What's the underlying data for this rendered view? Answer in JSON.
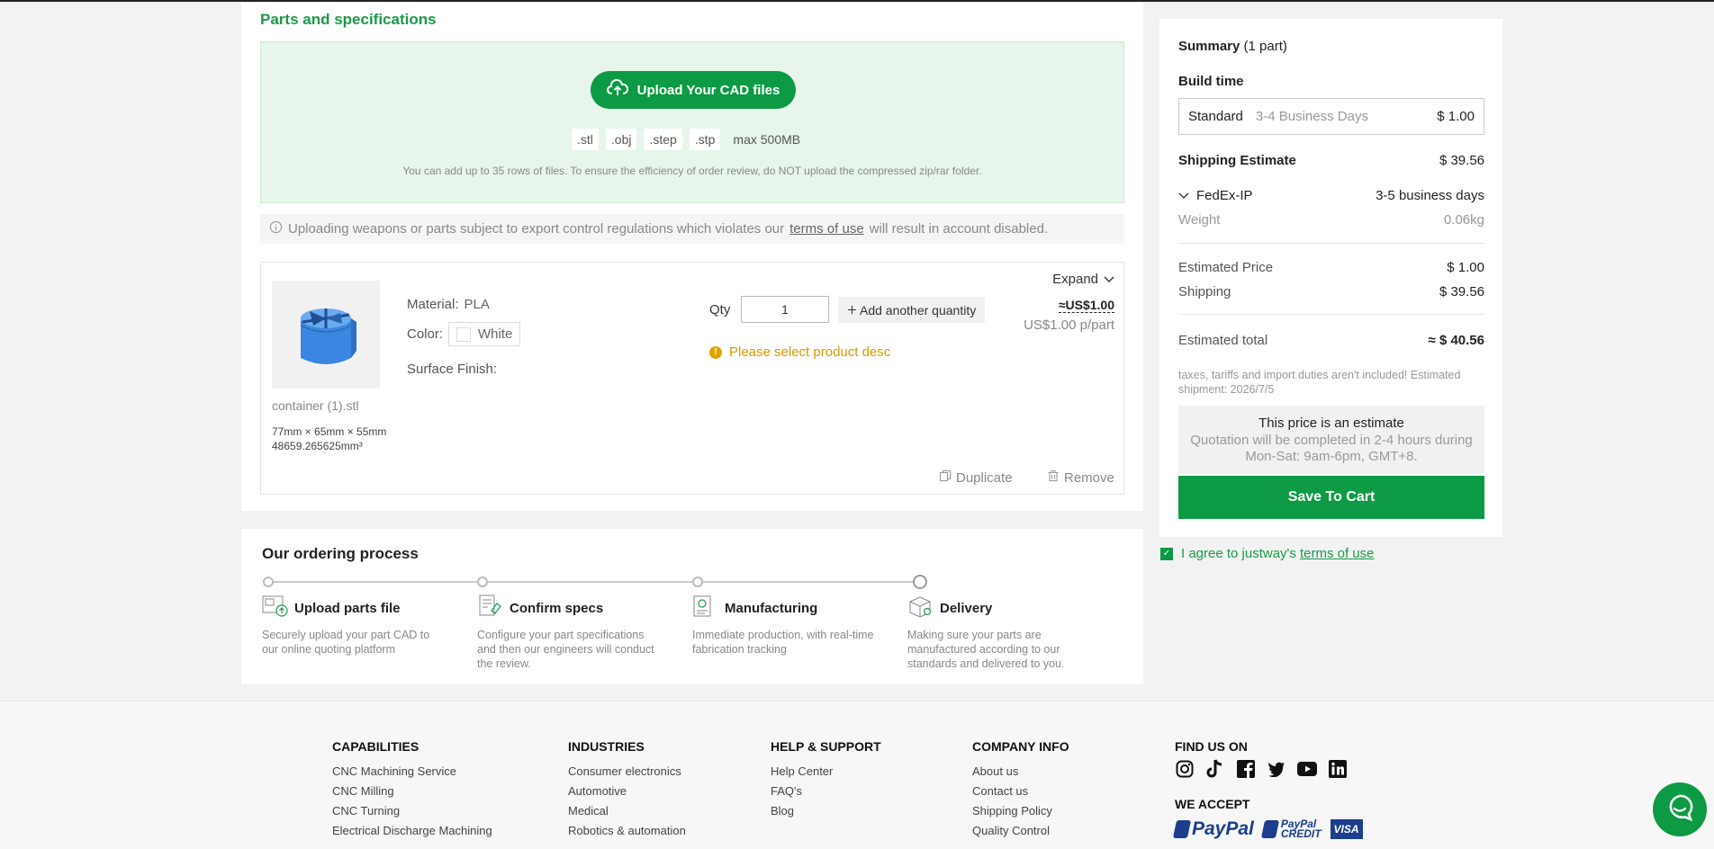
{
  "parts": {
    "title": "Parts and specifications",
    "upload_button": "Upload Your CAD files",
    "formats": [
      ".stl",
      ".obj",
      ".step",
      ".stp"
    ],
    "max_size": "max 500MB",
    "note": "You can add up to 35 rows of files. To ensure the efficiency of order review, do NOT upload the compressed zip/rar folder.",
    "warning_before": "Uploading weapons or parts subject to export control regulations which violates our",
    "warning_link": "terms of use",
    "warning_after": "will result in account disabled."
  },
  "part": {
    "file_name": "container (1).stl",
    "dimensions": "77mm × 65mm × 55mm",
    "volume": "48659.265625mm³",
    "material_label": "Material:",
    "material_value": "PLA",
    "color_label": "Color:",
    "color_value": "White",
    "surface_label": "Surface Finish:",
    "qty_label": "Qty",
    "qty_value": "1",
    "add_quantity": "Add another quantity",
    "expand": "Expand",
    "price": "≈US$1.00",
    "price_per": "US$1.00 p/part",
    "select_warning": "Please select product desc",
    "duplicate": "Duplicate",
    "remove": "Remove"
  },
  "process": {
    "title": "Our ordering process",
    "steps": [
      {
        "title": "Upload parts file",
        "desc": "Securely upload your part CAD to our online quoting platform"
      },
      {
        "title": "Confirm specs",
        "desc": "Configure your part specifications and then our engineers will conduct the review."
      },
      {
        "title": "Manufacturing",
        "desc": "Immediate production, with real-time fabrication tracking"
      },
      {
        "title": "Delivery",
        "desc": "Making sure your parts are manufactured according to our standards and delivered to you."
      }
    ]
  },
  "summary": {
    "title": "Summary",
    "count": "(1 part)",
    "build_time_label": "Build time",
    "build_option": "Standard",
    "build_days": "3-4 Business Days",
    "build_price": "$ 1.00",
    "shipping_estimate_label": "Shipping Estimate",
    "shipping_estimate_value": "$ 39.56",
    "carrier": "FedEx-IP",
    "carrier_days": "3-5 business days",
    "weight_label": "Weight",
    "weight_value": "0.06kg",
    "estimated_price_label": "Estimated Price",
    "estimated_price_value": "$ 1.00",
    "shipping_label": "Shipping",
    "shipping_value": "$ 39.56",
    "total_label": "Estimated total",
    "total_value": "≈ $ 40.56",
    "tax_note": "taxes, tariffs and import duties aren't included! Estimated shipment: 2026/7/5",
    "estimate_title": "This price is an estimate",
    "estimate_desc": "Quotation will be completed in 2-4 hours during Mon-Sat: 9am-6pm, GMT+8.",
    "save_button": "Save To Cart",
    "agree_text": "I agree to justway's",
    "agree_link": "terms of use"
  },
  "footer": {
    "capabilities": {
      "title": "CAPABILITIES",
      "links": [
        "CNC Machining Service",
        "CNC Milling",
        "CNC Turning",
        "Electrical Discharge Machining"
      ]
    },
    "industries": {
      "title": "INDUSTRIES",
      "links": [
        "Consumer electronics",
        "Automotive",
        "Medical",
        "Robotics & automation"
      ]
    },
    "help": {
      "title": "HELP & SUPPORT",
      "links": [
        "Help Center",
        "FAQ's",
        "Blog"
      ]
    },
    "company": {
      "title": "COMPANY INFO",
      "links": [
        "About us",
        "Contact us",
        "Shipping Policy",
        "Quality Control"
      ]
    },
    "find_us": "FIND US ON",
    "social_icons": [
      "instagram-icon",
      "tiktok-icon",
      "facebook-icon",
      "twitter-icon",
      "youtube-icon",
      "linkedin-icon"
    ],
    "we_accept": "WE ACCEPT",
    "pay_paypal": "PayPal",
    "pay_credit_top": "PayPal",
    "pay_credit_bottom": "CREDIT",
    "pay_visa": "VISA"
  },
  "colors": {
    "brand_green": "#0c9a44",
    "light_green": "#e7f5ea",
    "warning": "#d59a00",
    "paypal_blue": "#1c3e8c"
  }
}
